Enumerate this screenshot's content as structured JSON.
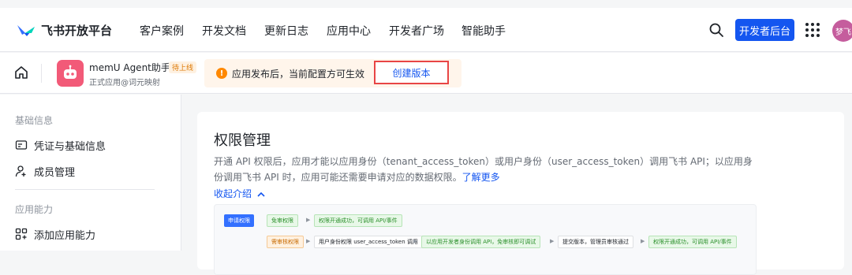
{
  "nav": {
    "logo_text": "飞书开放平台",
    "items": [
      "客户案例",
      "开发文档",
      "更新日志",
      "应用中心",
      "开发者广场",
      "智能助手"
    ],
    "dev_button": "开发者后台",
    "avatar_text": "梦飞"
  },
  "app": {
    "name": "memU Agent助手",
    "badge": "待上线",
    "subtitle": "正式应用@词元映射",
    "notice": "应用发布后，当前配置方可生效",
    "create_version": "创建版本"
  },
  "sidebar": {
    "group1": "基础信息",
    "item_credentials": "凭证与基础信息",
    "item_members": "成员管理",
    "group2": "应用能力",
    "item_add_capability": "添加应用能力"
  },
  "card": {
    "title": "权限管理",
    "desc": "开通 API 权限后，应用才能以应用身份（tenant_access_token）或用户身份（user_access_token）调用飞书 API；以应用身份调用飞书 API 时，应用可能还需要申请对应的数据权限。",
    "learn_more": "了解更多",
    "collapse": "收起介绍"
  },
  "diagram": {
    "apply": "申请权限",
    "free": "免审权限",
    "free_result": "权限开通成功，可调用 API/事件",
    "review": "需审核权限",
    "user_identity": "用户身份权限 user_access_token 调用",
    "user_result": "以应用开发者身份调用 API，免审核即可调试",
    "submit": "提交版本，管理员审核通过",
    "final": "权限开通成功，可调用 API/事件"
  },
  "colors": {
    "brand": "#1456f0",
    "highlight_border": "#e84545",
    "warning": "#ff8800"
  }
}
